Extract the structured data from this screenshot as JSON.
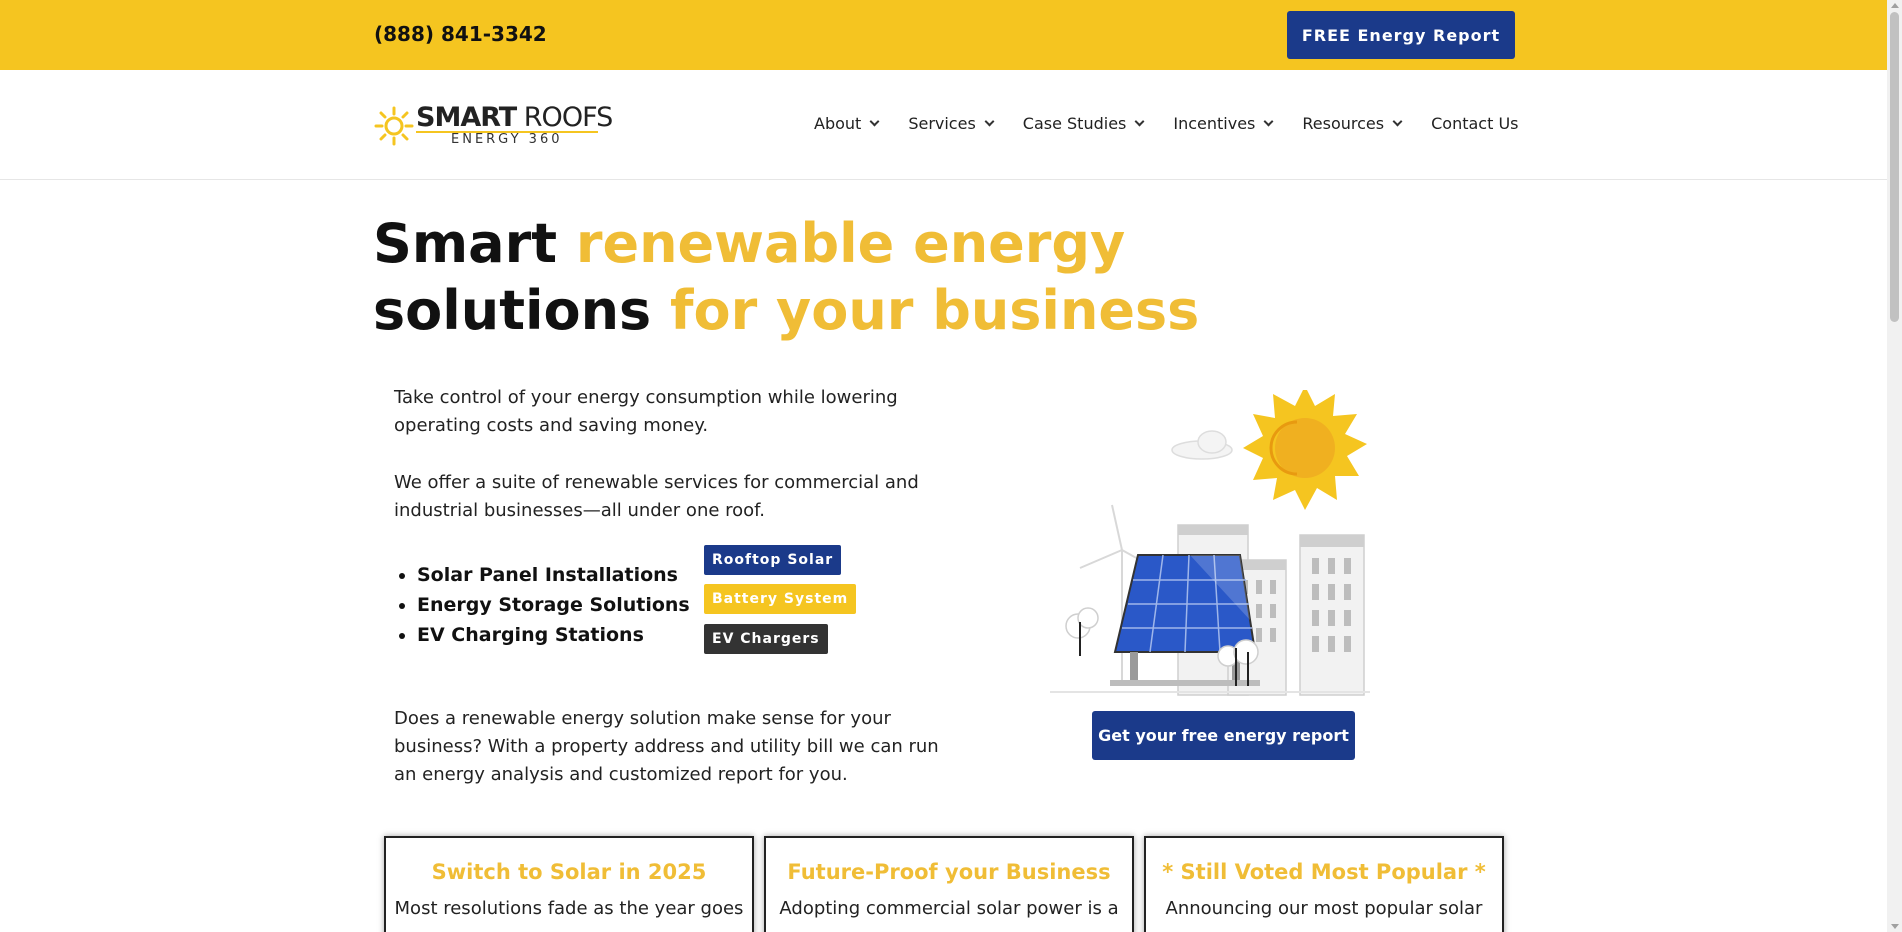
{
  "topbar": {
    "phone": "(888) 841-3342",
    "cta_label": "FREE Energy Report"
  },
  "logo": {
    "brand_bold": "SMART",
    "brand_light": " ROOFS",
    "sub": "ENERGY 360"
  },
  "nav": {
    "items": [
      {
        "label": "About",
        "has_dropdown": true
      },
      {
        "label": "Services",
        "has_dropdown": true
      },
      {
        "label": "Case Studies",
        "has_dropdown": true
      },
      {
        "label": "Incentives",
        "has_dropdown": true
      },
      {
        "label": "Resources",
        "has_dropdown": true
      },
      {
        "label": "Contact Us",
        "has_dropdown": false
      }
    ]
  },
  "hero": {
    "title_1": "Smart ",
    "title_2": "renewable energy",
    "title_3": "solutions ",
    "title_4": "for your business",
    "p1": "Take control of your energy consumption while lowering operating costs and saving money.",
    "p2": "We offer a suite of renewable services for commercial and industrial businesses—all under one roof.",
    "bullets": [
      "Solar Panel Installations",
      "Energy Storage Solutions",
      "EV Charging Stations"
    ],
    "tags": [
      "Rooftop Solar",
      "Battery System",
      "EV Chargers"
    ],
    "p3": "Does a renewable energy solution make sense for your business? With a property address and utility bill we can run an energy analysis and customized report for you.",
    "cta_label": "Get your free energy report"
  },
  "cards": [
    {
      "title": "Switch to Solar in 2025",
      "body": "Most resolutions fade as the year goes"
    },
    {
      "title": "Future-Proof your Business",
      "body": "Adopting commercial solar power is a"
    },
    {
      "title": "* Still Voted Most Popular *",
      "body": "Announcing our most popular solar"
    }
  ],
  "colors": {
    "accent_yellow": "#f5c520",
    "heading_yellow": "#f0bd36",
    "brand_blue": "#1b3a8a"
  },
  "icons": [
    "sun-logo-icon",
    "chevron-down-icon",
    "solar-city-illustration"
  ]
}
